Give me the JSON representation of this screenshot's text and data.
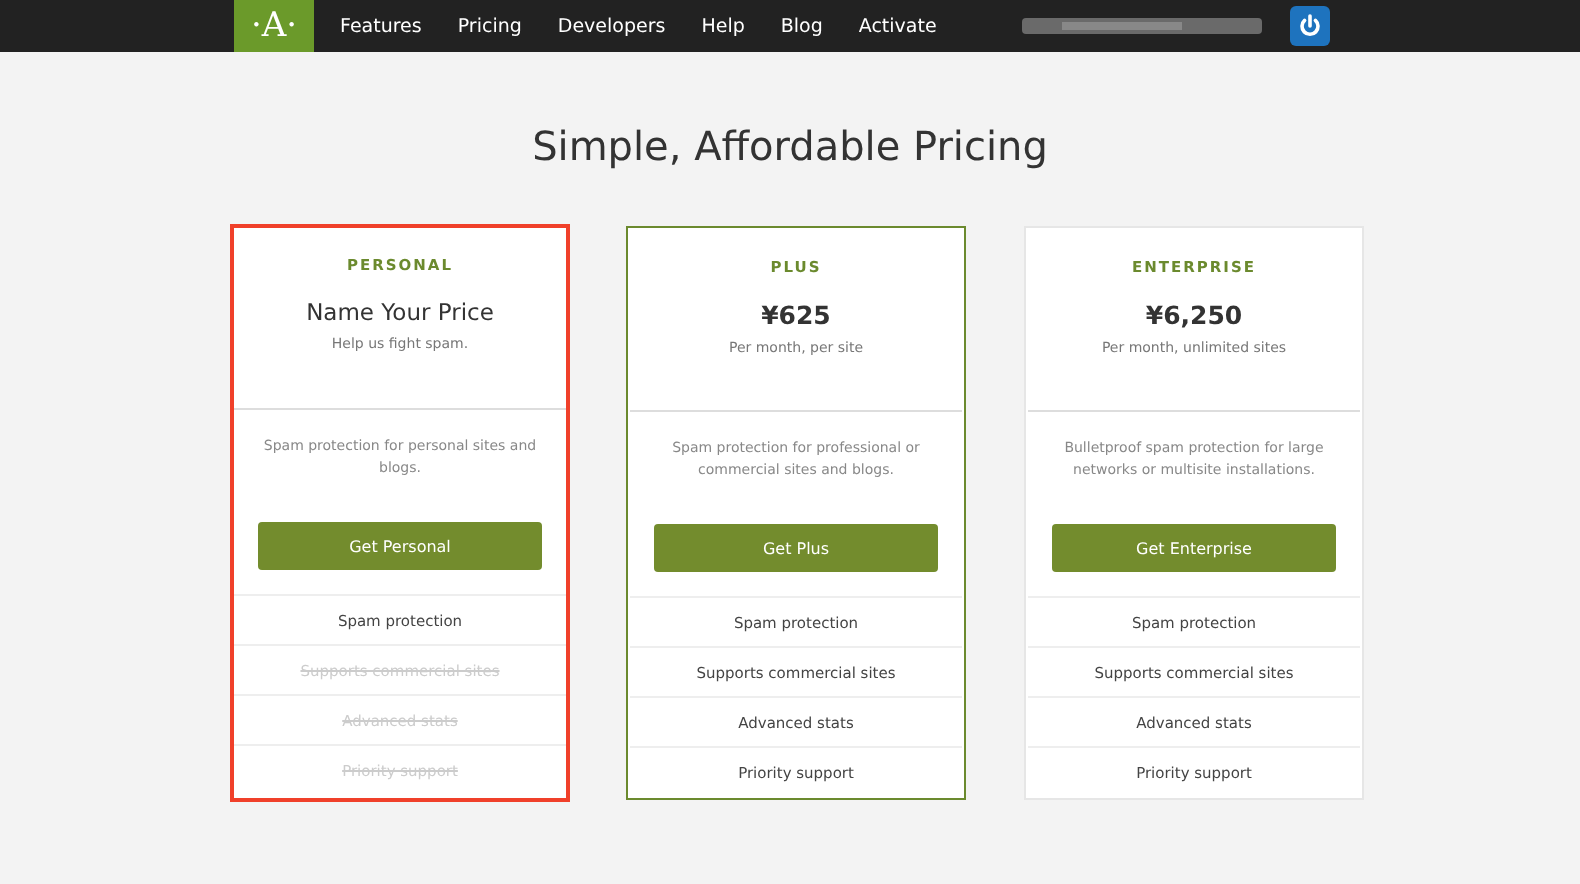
{
  "nav": {
    "logo": "·A·",
    "links": [
      "Features",
      "Pricing",
      "Developers",
      "Help",
      "Blog",
      "Activate"
    ]
  },
  "title": "Simple, Affordable Pricing",
  "plans": [
    {
      "name": "PERSONAL",
      "price": "Name Your Price",
      "kind": "text",
      "subtitle": "Help us fight spam.",
      "description": "Spam protection for personal sites and blogs.",
      "button": "Get Personal",
      "featured": false,
      "annotated": true,
      "features": [
        {
          "label": "Spam protection",
          "included": true
        },
        {
          "label": "Supports commercial sites",
          "included": false
        },
        {
          "label": "Advanced stats",
          "included": false
        },
        {
          "label": "Priority support",
          "included": false
        }
      ]
    },
    {
      "name": "PLUS",
      "price": "¥625",
      "kind": "amount",
      "subtitle": "Per month, per site",
      "description": "Spam protection for professional or commercial sites and blogs.",
      "button": "Get Plus",
      "featured": true,
      "annotated": false,
      "features": [
        {
          "label": "Spam protection",
          "included": true
        },
        {
          "label": "Supports commercial sites",
          "included": true
        },
        {
          "label": "Advanced stats",
          "included": true
        },
        {
          "label": "Priority support",
          "included": true
        }
      ]
    },
    {
      "name": "ENTERPRISE",
      "price": "¥6,250",
      "kind": "amount",
      "subtitle": "Per month, unlimited sites",
      "description": "Bulletproof spam protection for large networks or multisite installations.",
      "button": "Get Enterprise",
      "featured": false,
      "annotated": false,
      "features": [
        {
          "label": "Spam protection",
          "included": true
        },
        {
          "label": "Supports commercial sites",
          "included": true
        },
        {
          "label": "Advanced stats",
          "included": true
        },
        {
          "label": "Priority support",
          "included": true
        }
      ]
    }
  ]
}
